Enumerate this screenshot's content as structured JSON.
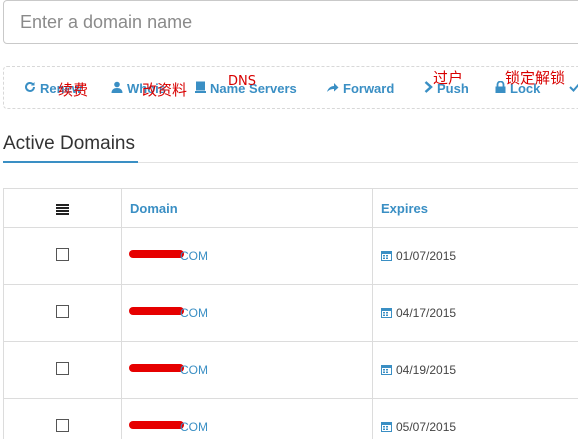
{
  "search": {
    "placeholder": "Enter a domain name"
  },
  "toolbar": {
    "items": [
      {
        "label": "Renew",
        "icon": "refresh-icon",
        "annotation": "续费"
      },
      {
        "label": "Whois",
        "icon": "user-icon",
        "annotation": "改资料"
      },
      {
        "label": "Name Servers",
        "icon": "server-icon",
        "annotation": "DNS"
      },
      {
        "label": "Forward",
        "icon": "forward-arrow-icon",
        "annotation": ""
      },
      {
        "label": "Push",
        "icon": "chevron-right-icon",
        "annotation": "过户"
      },
      {
        "label": "Lock",
        "icon": "lock-icon",
        "annotation": "锁定解锁"
      }
    ]
  },
  "section": {
    "title": "Active Domains"
  },
  "table": {
    "headers": [
      "Domain",
      "Expires"
    ],
    "rows": [
      {
        "domain_suffix": "COM",
        "expires": "01/07/2015"
      },
      {
        "domain_suffix": "COM",
        "expires": "04/17/2015"
      },
      {
        "domain_suffix": "COM",
        "expires": "04/19/2015"
      },
      {
        "domain_suffix": "COM",
        "expires": "05/07/2015"
      }
    ]
  },
  "colors": {
    "accent": "#3a8fc4",
    "annotation": "#d80000",
    "redaction": "#e60000"
  }
}
